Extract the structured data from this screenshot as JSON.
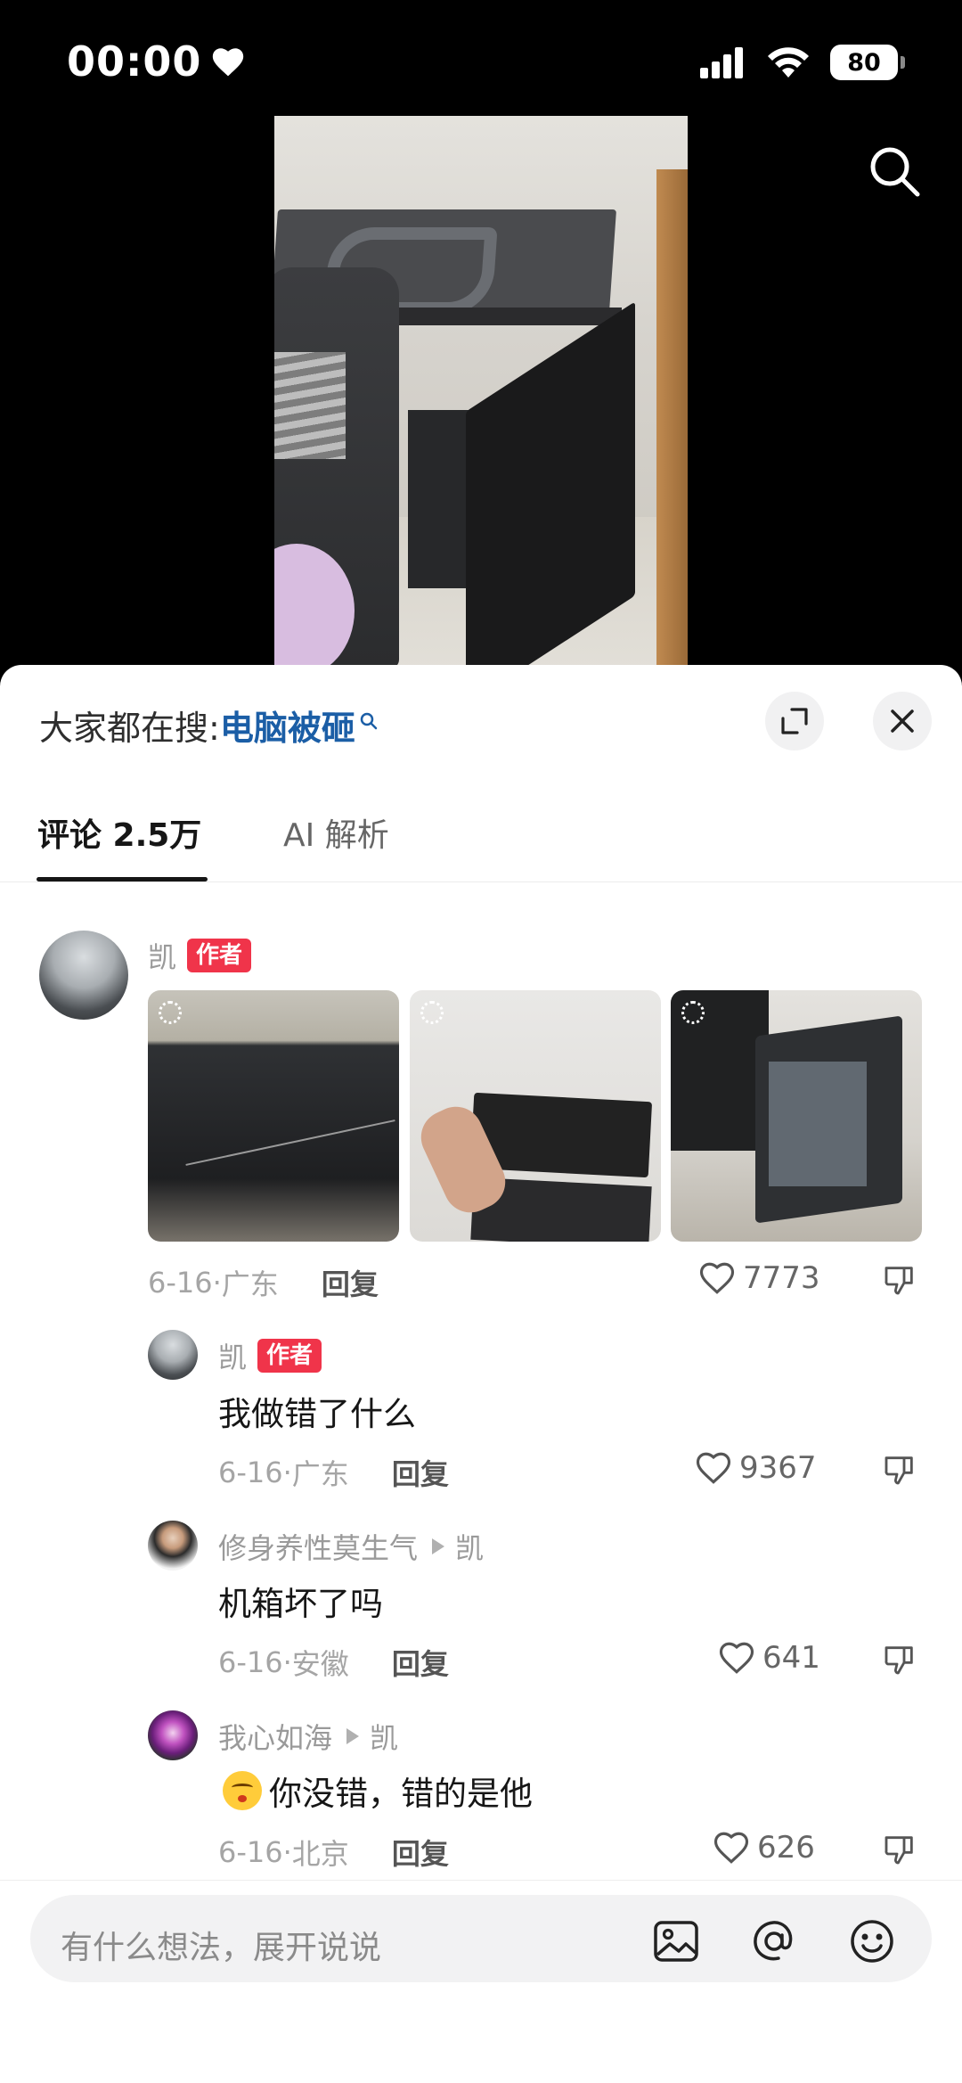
{
  "status_bar": {
    "time": "00:00",
    "battery": "80"
  },
  "sheet": {
    "hot_search_label": "大家都在搜:",
    "hot_search_keyword": "电脑被砸",
    "tabs": [
      {
        "label": "评论 2.5万",
        "active": true
      },
      {
        "label": "AI 解析",
        "active": false
      }
    ]
  },
  "comments": [
    {
      "author": "凯",
      "badge": "作者",
      "text": "",
      "images": [
        "cracked-monitor-photo",
        "keyboard-photo",
        "pc-case-photo"
      ],
      "date": "6-16",
      "location": "广东",
      "reply_label": "回复",
      "likes": "7773"
    },
    {
      "author": "凯",
      "badge": "作者",
      "text": "我做错了什么",
      "date": "6-16",
      "location": "广东",
      "reply_label": "回复",
      "likes": "9367"
    },
    {
      "author": "修身养性莫生气",
      "reply_to": "凯",
      "text": "机箱坏了吗",
      "date": "6-16",
      "location": "安徽",
      "reply_label": "回复",
      "likes": "641"
    },
    {
      "author": "我心如海",
      "reply_to": "凯",
      "text": "你没错，错的是他",
      "emoji": "kissing-face-emoji",
      "date": "6-16",
      "location": "北京",
      "reply_label": "回复",
      "likes": "626"
    }
  ],
  "composer": {
    "placeholder": "有什么想法，展开说说"
  },
  "colors": {
    "accent_link": "#1b5ea6",
    "author_badge": "#f0344a",
    "text_primary": "#161616",
    "text_secondary": "#a5a5a5"
  }
}
